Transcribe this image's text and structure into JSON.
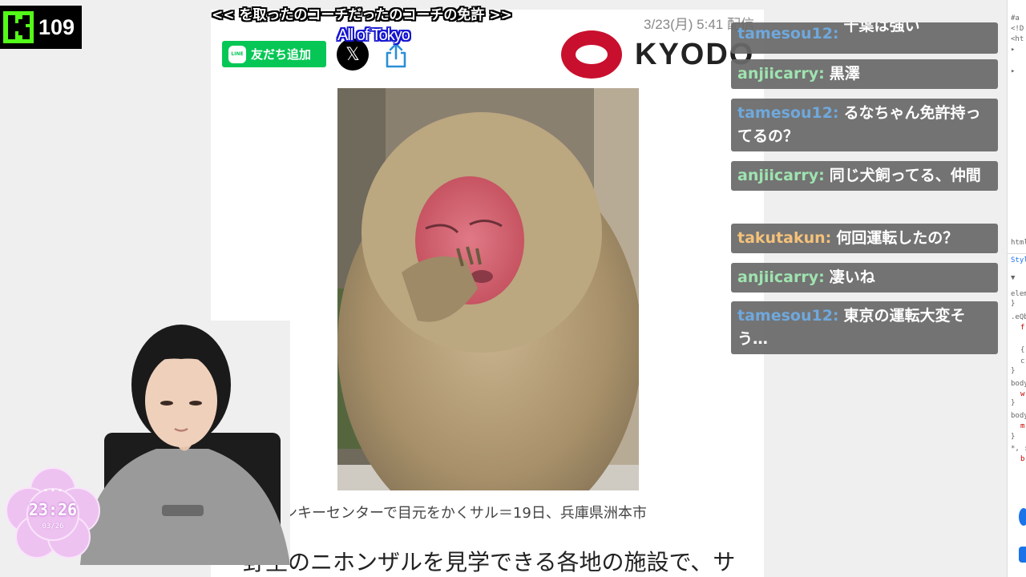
{
  "kick": {
    "viewer_count": "109"
  },
  "subtitles": {
    "top": "<< を取ったのコーチだったのコーチの免許 >>",
    "secondary": "All of Tokyo"
  },
  "article": {
    "date": "3/23(月) 5:41 配信",
    "line_button_label": "友だち追加",
    "line_icon_text": "LINE",
    "x_label": "𝕏",
    "publisher": "KYODO",
    "caption": "ンキーセンターで目元をかくサル＝19日、兵庫県洲本市",
    "body_start": "野生のニホンザルを見学できる各地の施設で、サ"
  },
  "chat": {
    "messages": [
      {
        "user": "tamesou12:",
        "text": "千葉は強い",
        "color": "#6fa8dc"
      },
      {
        "user": "anjiicarry:",
        "text": "黒澤",
        "color": "#9fe3b0"
      },
      {
        "user": "tamesou12:",
        "text": "るなちゃん免許持ってるの？",
        "color": "#6fa8dc"
      },
      {
        "user": "anjiicarry:",
        "text": "同じ犬飼ってる、仲間",
        "color": "#9fe3b0"
      },
      {
        "user": "takutakun:",
        "text": "何回運転したの？",
        "color": "#f5c27a"
      },
      {
        "user": "anjiicarry:",
        "text": "凄いね",
        "color": "#9fe3b0"
      },
      {
        "user": "tamesou12:",
        "text": "東京の運転大変そう…",
        "color": "#6fa8dc"
      }
    ]
  },
  "clock": {
    "time": "23:26",
    "date": "03/26",
    "dots": "• • •"
  },
  "devtools": {
    "lines": [
      "#a",
      "<!D",
      "<ht",
      "▸",
      "▸",
      "html",
      "Styl",
      "▼",
      "elem",
      "}",
      ".eQb",
      "f",
      "{",
      "c",
      "}",
      "body",
      "w",
      "}",
      "body",
      "m",
      "}",
      "*, :",
      "b"
    ]
  },
  "colors": {
    "kick_green": "#53fc18",
    "line_green": "#06c755",
    "kyodo_red": "#c8102e",
    "chat_bg": "#696969"
  }
}
